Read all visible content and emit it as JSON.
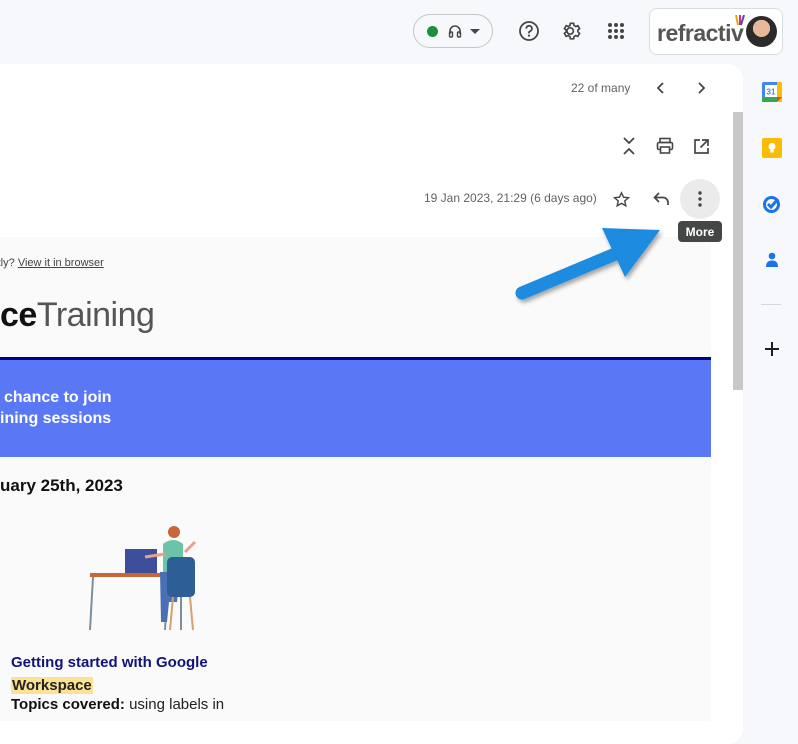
{
  "topbar": {
    "status_indicator": {
      "color": "#1e8e3e",
      "icon": "headset-icon"
    },
    "help_icon": "help-icon",
    "settings_icon": "gear-icon",
    "apps_icon": "apps-grid-icon",
    "account": {
      "org_logo": "refractiv",
      "avatar": "user-avatar"
    }
  },
  "toolbar": {
    "counter": "22 of many",
    "prev_icon": "chevron-left-icon",
    "next_icon": "chevron-right-icon",
    "expand_icon": "collapse-all-icon",
    "print_icon": "print-icon",
    "popout_icon": "open-in-new-window-icon"
  },
  "message": {
    "date": "19 Jan 2023, 21:29 (6 days ago)",
    "star_icon": "star-icon",
    "reply_icon": "reply-icon",
    "more_icon": "more-vertical-icon",
    "tooltip": "More"
  },
  "email": {
    "view_prefix": "ectly?",
    "view_link": "View it in browser",
    "logo_bold": "ce",
    "logo_light": "Training",
    "banner_line1": "chance to join",
    "banner_line2": "ining sessions",
    "session_date": "uary 25th, 2023",
    "course_title_line1": "Getting started with Google",
    "course_title_highlight": "Workspace",
    "topics_label": "Topics covered:",
    "topics_text": " using labels in",
    "colors": {
      "banner": "#5a78f5",
      "rule": "#000080",
      "title": "#12127a",
      "highlight": "#fde293"
    }
  },
  "annotation": {
    "arrow_color": "#1a8be0",
    "points_to": "more-button"
  },
  "sidebar": {
    "items": [
      {
        "name": "calendar",
        "label": "31"
      },
      {
        "name": "keep"
      },
      {
        "name": "tasks"
      },
      {
        "name": "contacts"
      }
    ],
    "add_icon": "plus-icon"
  }
}
